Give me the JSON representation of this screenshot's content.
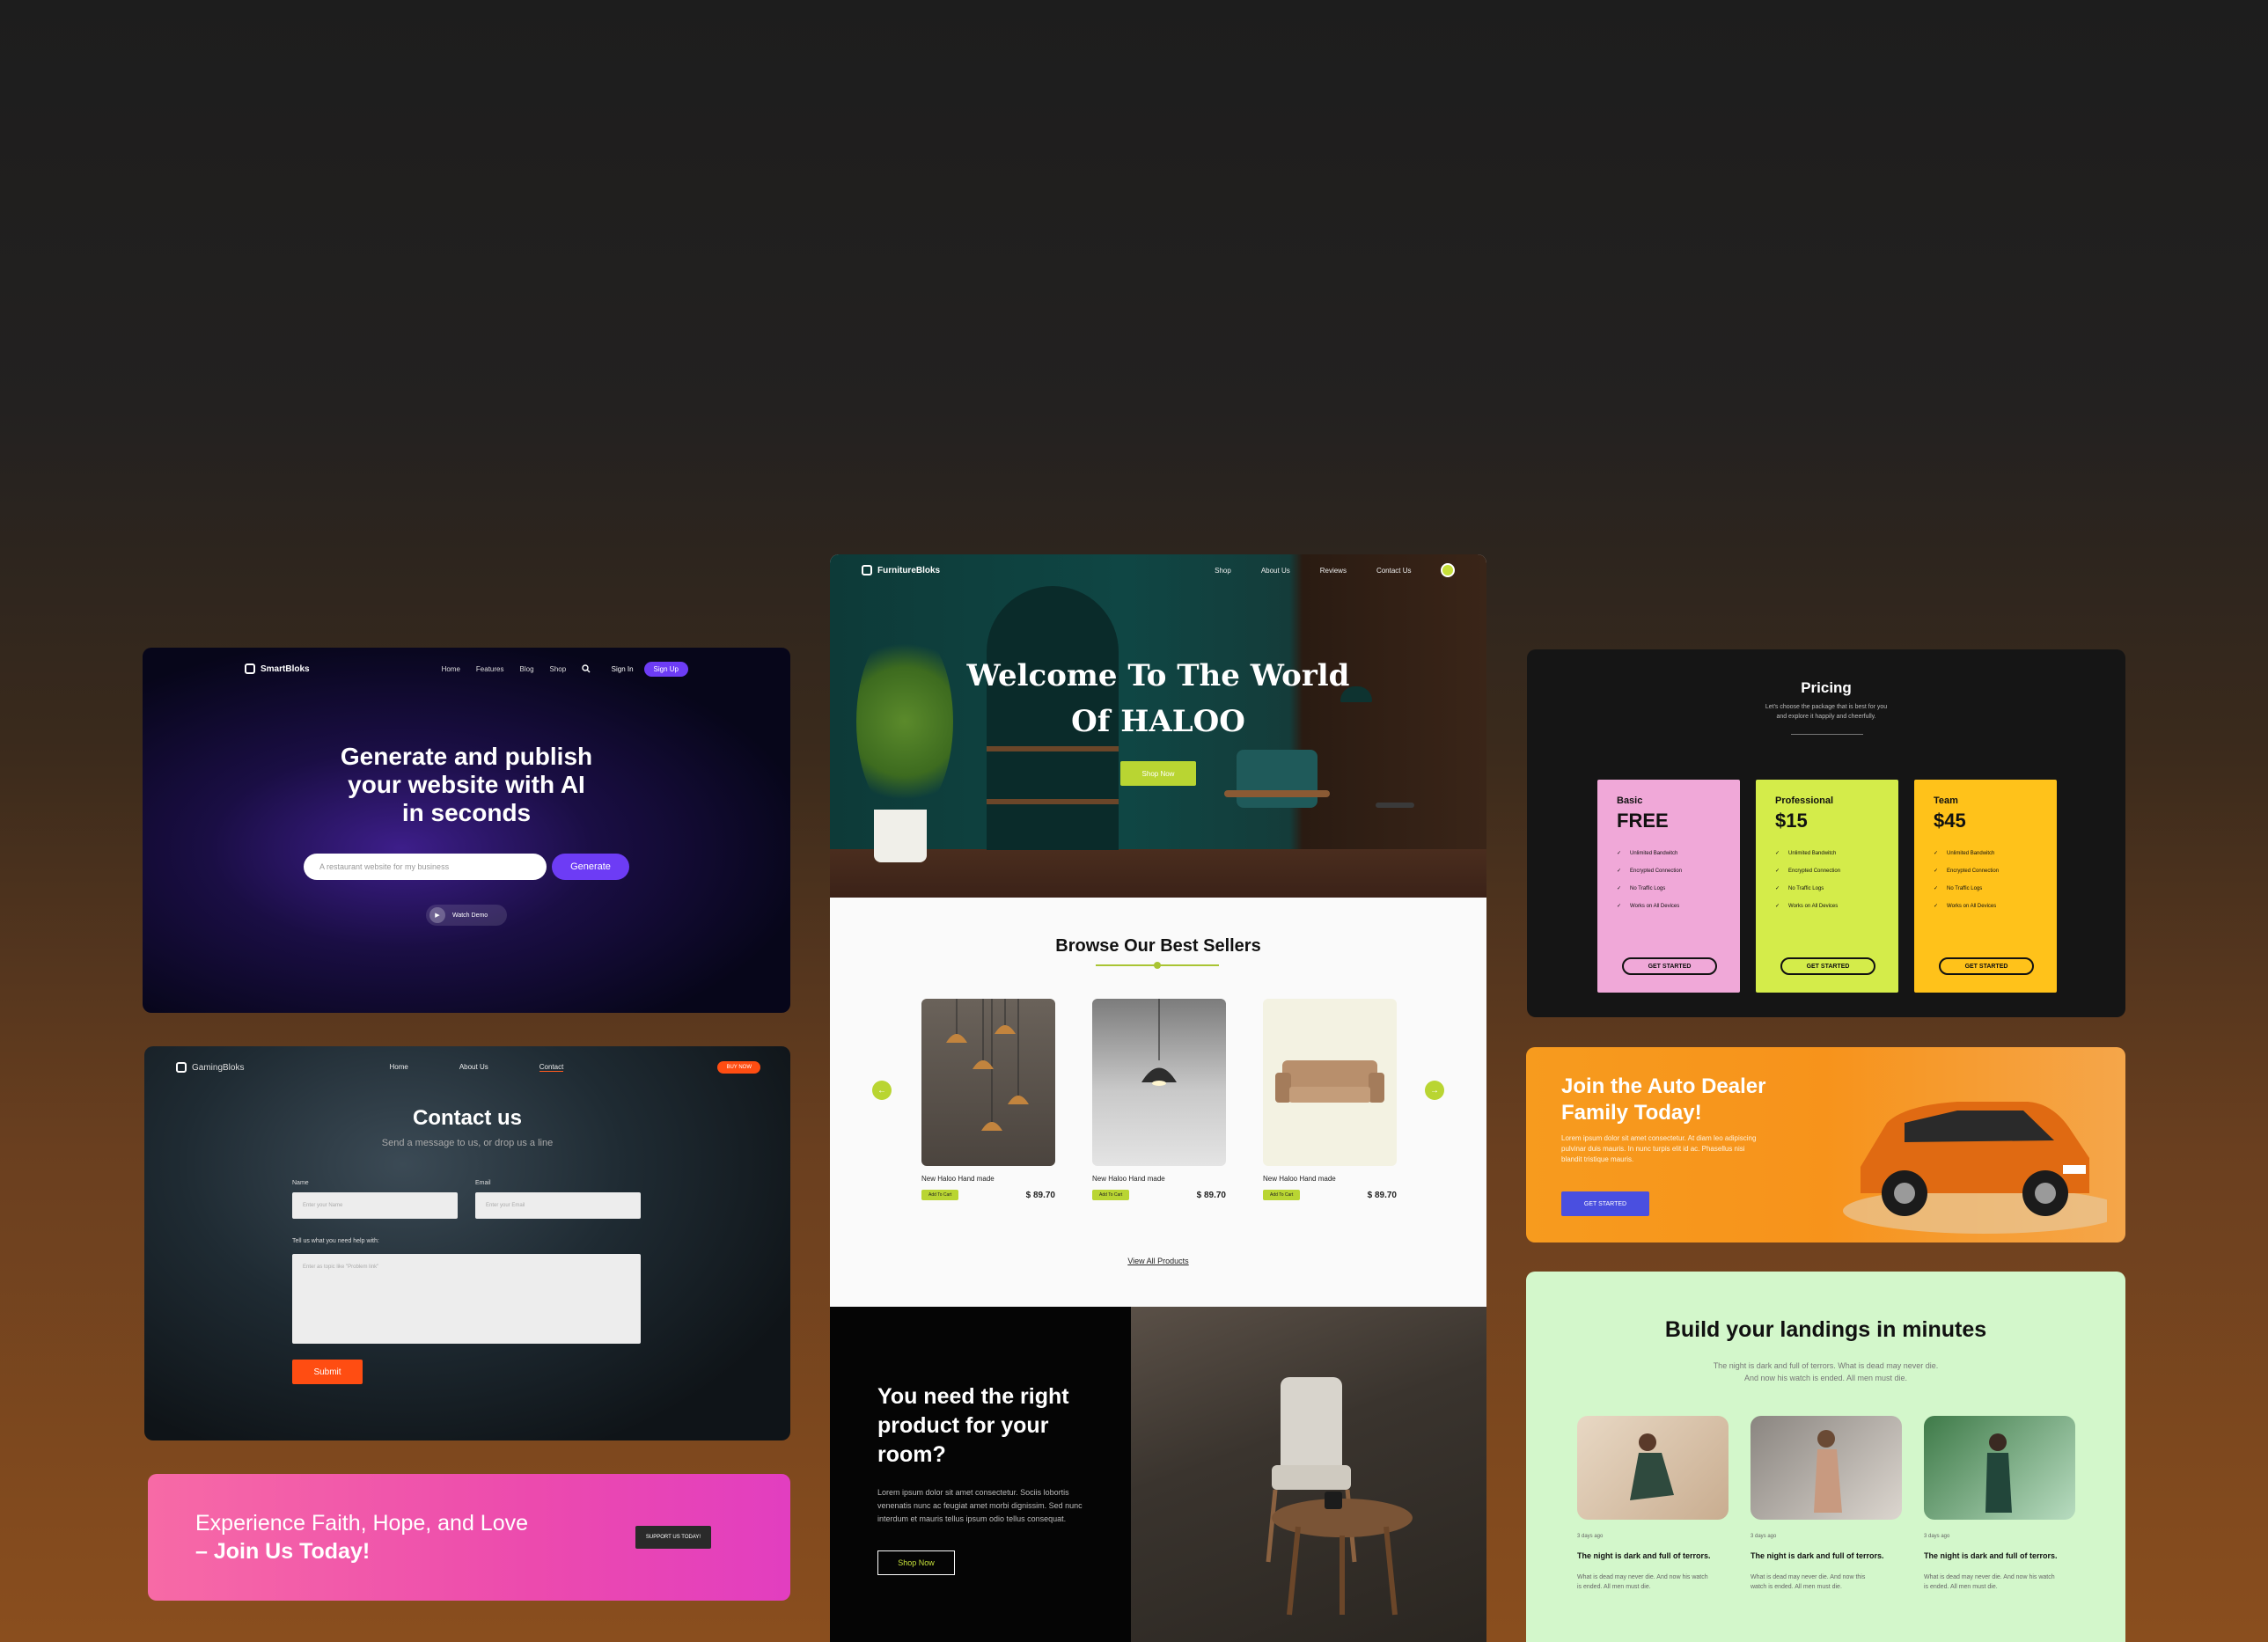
{
  "smart": {
    "brand": "SmartBloks",
    "nav": [
      "Home",
      "Features",
      "Blog",
      "Shop"
    ],
    "signin": "Sign In",
    "signup": "Sign Up",
    "headline_1": "Generate and publish",
    "headline_2": "your website with AI",
    "headline_3": "in seconds",
    "input_placeholder": "A restaurant website for my business",
    "generate": "Generate",
    "watch": "Watch Demo"
  },
  "gaming": {
    "brand": "GamingBloks",
    "nav": [
      "Home",
      "About Us",
      "Contact"
    ],
    "buy": "BUY NOW",
    "title": "Contact us",
    "subtitle": "Send a message to us, or drop us a line",
    "name_label": "Name",
    "name_placeholder": "Enter your Name",
    "email_label": "Email",
    "email_placeholder": "Enter your Email",
    "help_label": "Tell us what you need help with:",
    "help_placeholder": "Enter as topic like \"Problem link\"",
    "submit": "Submit"
  },
  "faith": {
    "line1": "Experience Faith, Hope, and Love",
    "line2": "– Join Us Today!",
    "button": "SUPPORT US TODAY!"
  },
  "furniture": {
    "brand": "FurnitureBloks",
    "nav": [
      "Shop",
      "About Us",
      "Reviews",
      "Contact Us"
    ],
    "hero_1": "Welcome To The World",
    "hero_2": "Of HALOO",
    "shop_now": "Shop Now",
    "best_title": "Browse Our Best Sellers",
    "products": [
      {
        "name": "New Haloo Hand made",
        "cart": "Add To Cart",
        "price": "$ 89.70"
      },
      {
        "name": "New Haloo Hand made",
        "cart": "Add To Cart",
        "price": "$ 89.70"
      },
      {
        "name": "New Haloo Hand made",
        "cart": "Add To Cart",
        "price": "$ 89.70"
      }
    ],
    "view_all": "View All Products",
    "promo_title": "You need the right product for your room?",
    "promo_text": "Lorem ipsum dolor sit amet consectetur. Sociis lobortis venenatis nunc ac feugiat amet morbi dignissim. Sed nunc interdum et mauris tellus ipsum odio tellus consequat.",
    "promo_btn": "Shop Now"
  },
  "pricing": {
    "title": "Pricing",
    "sub1": "Let's choose the package that is best for you",
    "sub2": "and explore it happily and cheerfully.",
    "features": [
      "Unlimited Bandwitch",
      "Encrypted Connection",
      "No Traffic Logs",
      "Works on All Devices"
    ],
    "get_started": "GET STARTED",
    "plans": [
      {
        "name": "Basic",
        "price": "FREE",
        "color": "#f0a8d8"
      },
      {
        "name": "Professional",
        "price": "$15",
        "color": "#d4ec4a"
      },
      {
        "name": "Team",
        "price": "$45",
        "color": "#ffc21a"
      }
    ]
  },
  "auto": {
    "title": "Join the Auto Dealer Family Today!",
    "text": "Lorem ipsum dolor sit amet consectetur. At diam leo adipiscing pulvinar duis mauris. In nunc turpis elit id ac. Phasellus nisi blandit tristique mauris.",
    "button": "GET STARTED"
  },
  "landings": {
    "title": "Build your landings in minutes",
    "sub1": "The night is dark and full of terrors. What is dead may never die.",
    "sub2": "And now his watch is ended. All men must die.",
    "posts": [
      {
        "date": "3 days ago",
        "title": "The night is dark and full of terrors.",
        "desc": "What is dead may never die. And now his watch is ended. All men must die."
      },
      {
        "date": "3 days ago",
        "title": "The night is dark and full of terrors.",
        "desc": "What is dead may never die. And now this watch is ended. All men must die."
      },
      {
        "date": "3 days ago",
        "title": "The night is dark and full of terrors.",
        "desc": "What is dead may never die. And now his watch is ended. All men must die."
      }
    ]
  }
}
